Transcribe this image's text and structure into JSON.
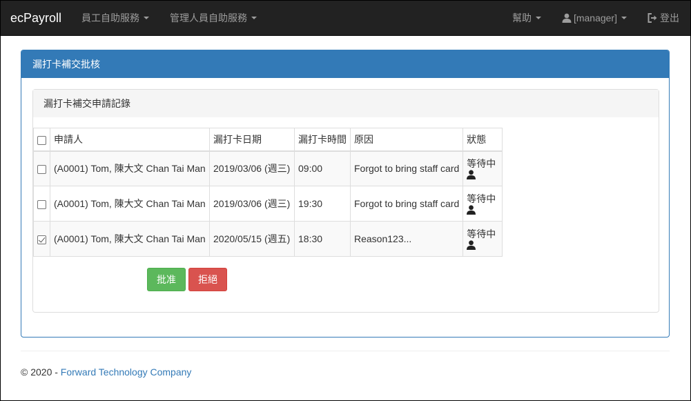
{
  "navbar": {
    "brand": "ecPayroll",
    "menu": [
      "員工自助服務",
      "管理人員自助服務"
    ],
    "help": "幫助",
    "user": "[manager]",
    "logout": "登出"
  },
  "panel": {
    "title": "漏打卡補交批核",
    "inner_title": "漏打卡補交申請記錄"
  },
  "table": {
    "headers": [
      "申請人",
      "漏打卡日期",
      "漏打卡時間",
      "原因",
      "狀態"
    ],
    "rows": [
      {
        "applicant": "(A0001) Tom, 陳大文 Chan Tai Man",
        "date": "2019/03/06 (週三)",
        "time": "09:00",
        "reason": "Forgot to bring staff card",
        "status": "等待中",
        "checked": false
      },
      {
        "applicant": "(A0001) Tom, 陳大文 Chan Tai Man",
        "date": "2019/03/06 (週三)",
        "time": "19:30",
        "reason": "Forgot to bring staff card",
        "status": "等待中",
        "checked": false
      },
      {
        "applicant": "(A0001) Tom, 陳大文 Chan Tai Man",
        "date": "2020/05/15 (週五)",
        "time": "18:30",
        "reason": "Reason123...",
        "status": "等待中",
        "checked": true
      }
    ]
  },
  "actions": {
    "approve": "批准",
    "reject": "拒絕"
  },
  "footer": {
    "copyright": "© 2020 - ",
    "company": "Forward Technology Company"
  },
  "colors": {
    "navbar": "#222222",
    "primary": "#337ab7",
    "approve": "#5cb85c",
    "reject": "#d9534f"
  },
  "icons": {
    "user": "user-icon",
    "logout": "logout-icon",
    "status": "person-icon"
  }
}
